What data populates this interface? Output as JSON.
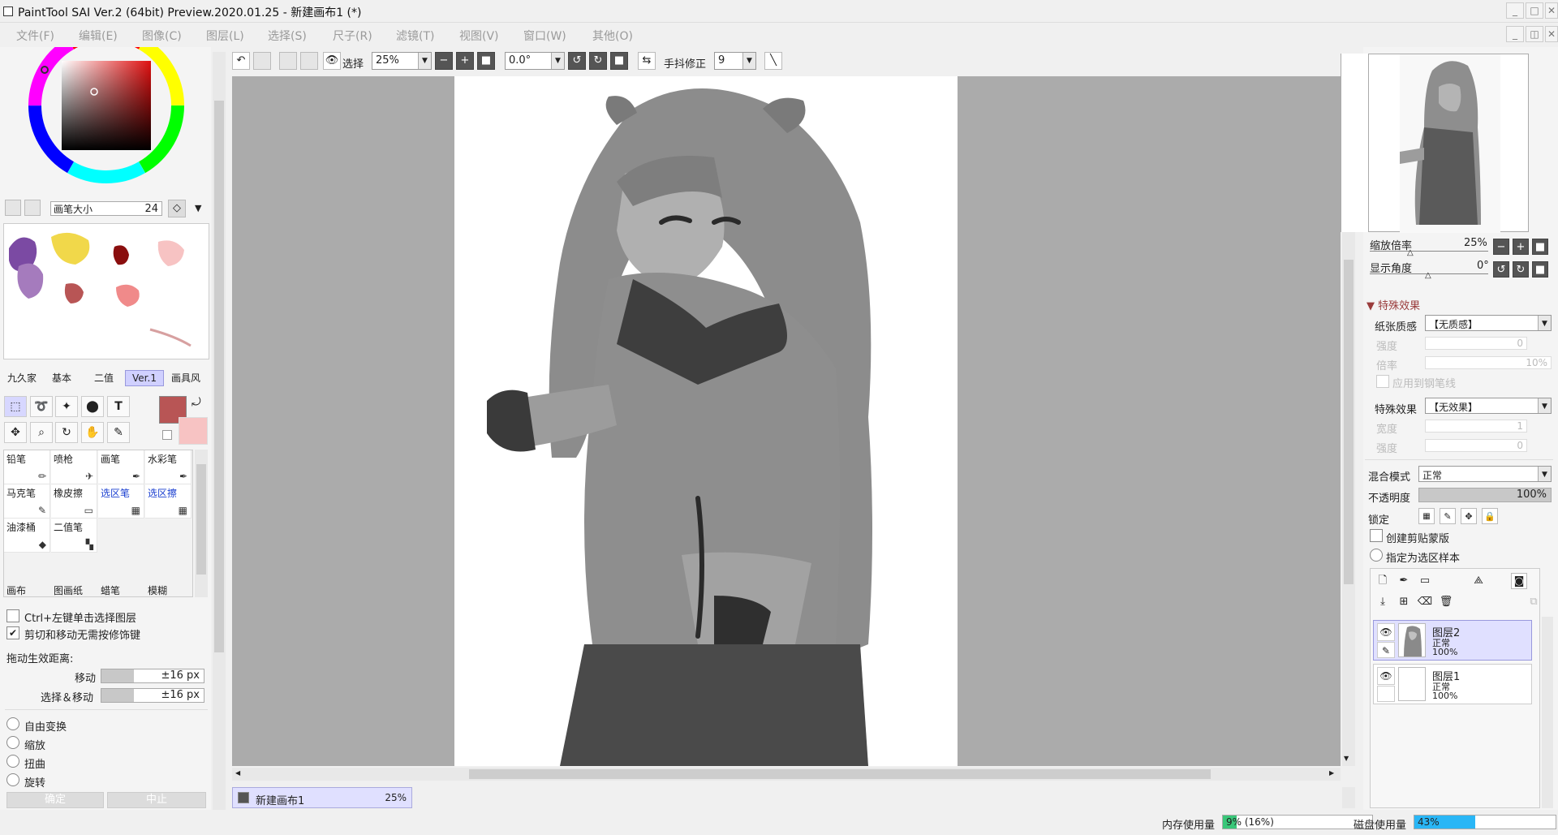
{
  "window": {
    "title": "PaintTool SAI Ver.2 (64bit) Preview.2020.01.25 - 新建画布1 (*)"
  },
  "menu": [
    "文件(F)",
    "编辑(E)",
    "图像(C)",
    "图层(L)",
    "选择(S)",
    "尺子(R)",
    "滤镜(T)",
    "视图(V)",
    "窗口(W)",
    "其他(O)"
  ],
  "toolbar": {
    "select_label": "选择",
    "zoom": "25%",
    "angle": "0.0°",
    "stabilizer_label": "手抖修正",
    "stabilizer_value": "9"
  },
  "brush": {
    "size_label": "画笔大小",
    "size_value": "24"
  },
  "tool_tabs": [
    "九久家",
    "基本",
    "二值",
    "Ver.1",
    "画具风"
  ],
  "brushes": [
    {
      "label": "铅笔",
      "blue": false
    },
    {
      "label": "喷枪",
      "blue": false
    },
    {
      "label": "画笔",
      "blue": false
    },
    {
      "label": "水彩笔",
      "blue": false
    },
    {
      "label": "马克笔",
      "blue": false
    },
    {
      "label": "橡皮擦",
      "blue": false
    },
    {
      "label": "选区笔",
      "blue": true
    },
    {
      "label": "选区擦",
      "blue": true
    },
    {
      "label": "油漆桶",
      "blue": false
    },
    {
      "label": "二值笔",
      "blue": false
    }
  ],
  "brush_bottom": [
    "画布",
    "图画纸",
    "蜡笔",
    "模糊"
  ],
  "options": {
    "ctrl_click": "Ctrl+左键单击选择图层",
    "ctrl_checked": false,
    "cut_move": "剪切和移动无需按修饰键",
    "cut_checked": true,
    "drag_distance": "拖动生效距离:",
    "move_label": "移动",
    "move_value": "±16 px",
    "selmove_label": "选择＆移动",
    "selmove_value": "±16 px",
    "radios": [
      "自由变换",
      "缩放",
      "扭曲",
      "旋转"
    ],
    "ok": "确定",
    "cancel": "中止"
  },
  "canvas_tab": {
    "name": "新建画布1",
    "zoom": "25%"
  },
  "nav": {
    "zoom_label": "缩放倍率",
    "zoom_value": "25%",
    "angle_label": "显示角度",
    "angle_value": "0°"
  },
  "effects": {
    "header": "特殊效果",
    "paper_label": "纸张质感",
    "paper_value": "【无质感】",
    "strength_label": "强度",
    "strength_value": "0",
    "ratio_label": "倍率",
    "ratio_value": "10%",
    "apply_label": "应用到钢笔线",
    "effect_label": "特殊效果",
    "effect_value": "【无效果】",
    "width_label": "宽度",
    "width_value": "1",
    "strength2_label": "强度",
    "strength2_value": "0"
  },
  "layerprops": {
    "blend_label": "混合模式",
    "blend_value": "正常",
    "opacity_label": "不透明度",
    "opacity_value": "100%",
    "lock_label": "锁定",
    "clip_label": "创建剪贴蒙版",
    "sample_label": "指定为选区样本"
  },
  "layers": [
    {
      "name": "图层2",
      "mode": "正常",
      "opacity": "100%",
      "selected": true
    },
    {
      "name": "图层1",
      "mode": "正常",
      "opacity": "100%",
      "selected": false
    }
  ],
  "status": {
    "mem_label": "内存使用量",
    "mem_value": "9% (16%)",
    "mem_fill": 0.09,
    "disk_label": "磁盘使用量",
    "disk_value": "43%",
    "disk_fill": 0.43
  },
  "colors": {
    "fg": "#b85555",
    "bg": "#f7c3c3",
    "accent": "#d0d0ff"
  }
}
